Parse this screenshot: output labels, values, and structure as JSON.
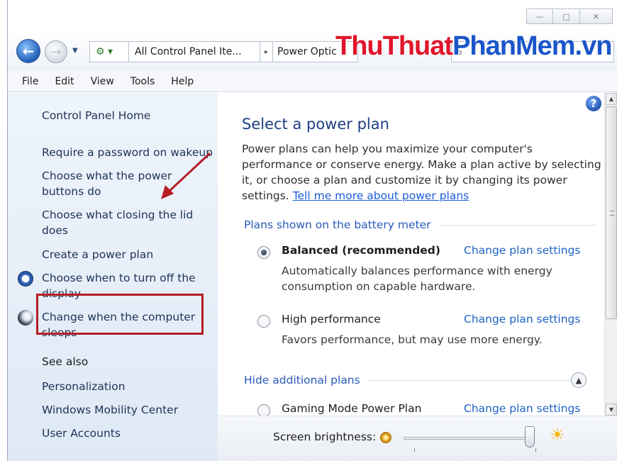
{
  "window": {
    "caption_minimize": "—",
    "caption_maximize": "□",
    "caption_close": "✕"
  },
  "nav": {
    "back_icon": "←",
    "forward_icon": "→",
    "dropdown_icon": "▼",
    "cp_icon": "⚙ ▾",
    "breadcrumb_1": "All Control Panel Ite...",
    "breadcrumb_sep": "▸",
    "breadcrumb_2": "Power Optic",
    "search_placeholder": "S"
  },
  "watermark": {
    "part1": "ThuThuat",
    "part2": "PhanMem.vn"
  },
  "menu": [
    "File",
    "Edit",
    "View",
    "Tools",
    "Help"
  ],
  "sidebar": {
    "home": "Control Panel Home",
    "links": [
      "Require a password on wakeup",
      "Choose what the power buttons do",
      "Choose what closing the lid does",
      "Create a power plan",
      "Choose when to turn off the display",
      "Change when the computer sleeps"
    ],
    "see_also_heading": "See also",
    "see_also": [
      "Personalization",
      "Windows Mobility Center",
      "User Accounts"
    ]
  },
  "main": {
    "help_icon": "?",
    "title": "Select a power plan",
    "intro": "Power plans can help you maximize your computer's performance or conserve energy. Make a plan active by selecting it, or choose a plan and customize it by changing its power settings.",
    "intro_link": "Tell me more about power plans",
    "section_battery": "Plans shown on the battery meter",
    "plans": [
      {
        "name": "Balanced (recommended)",
        "selected": true,
        "link": "Change plan settings",
        "desc": "Automatically balances performance with energy consumption on capable hardware."
      },
      {
        "name": "High performance",
        "selected": false,
        "link": "Change plan settings",
        "desc": "Favors performance, but may use more energy."
      },
      {
        "name": "Gaming Mode Power Plan",
        "selected": false,
        "link": "Change plan settings"
      }
    ],
    "section_additional": "Hide additional plans",
    "expander_icon": "▲"
  },
  "brightness": {
    "label": "Screen brightness:",
    "level_percent": 100,
    "bright_icon": "☀"
  },
  "scrollbar": {
    "up": "▲",
    "down": "▼"
  },
  "colors": {
    "highlight_border": "#b41e24",
    "link": "#1e63c4",
    "title": "#1e3f82"
  }
}
